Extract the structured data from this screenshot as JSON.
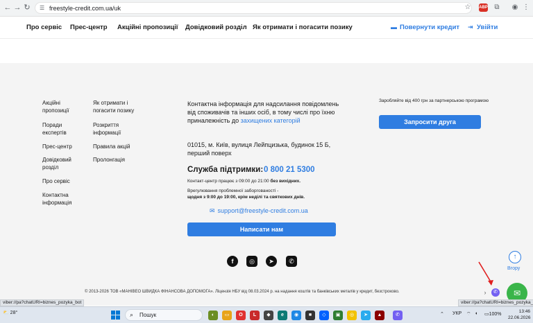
{
  "browser": {
    "url": "freestyle-credit.com.ua/uk",
    "abp_label": "ABP"
  },
  "header": {
    "menu": [
      "Про сервіс",
      "Прес-центр",
      "Акційні пропозиції",
      "Довідковий розділ",
      "Як отримати і погасити позику"
    ],
    "return_credit": "Повернути кредит",
    "login": "Увійти"
  },
  "footer": {
    "col1": [
      "Акційні пропозиції",
      "Поради експертів",
      "Прес-центр",
      "Довідковий розділ",
      "Про сервіс",
      "Контактна інформація"
    ],
    "col2": [
      "Як отримати і погасити позику",
      "Розкриття інформації",
      "Правила акцій",
      "Пролонгація"
    ],
    "contact_text": "Контактна інформація для надсилання повідомлень від споживачів та інших осіб, в тому числі про їхню приналежність до",
    "contact_link": "захищених категорій",
    "address": "01015, м. Київ, вулиця Лейпцизька, будинок 15 Б, перший поверх",
    "support_title": "Служба підтримки:",
    "support_phone": "0 800 21 5300",
    "hours_prefix": "Контакт-центр працює з 09:00 до 21:00",
    "hours_bold": "без вихідних.",
    "problem_text": "Врегулювання проблемної заборгованості -",
    "problem_bold": "щодня з 9:00 до 19:00, крім неділі та святкових днів.",
    "email": "support@freestyle-credit.com.ua",
    "write_button": "Написати нам",
    "partner_text": "Заробляйте від 400 грн за партнерською програмою",
    "invite_button": "Запросити друга",
    "copyright": "© 2013-2026 ТОВ «МАНІВЕО ШВИДКА ФІНАНСОВА ДОПОМОГА». Ліцензія НБУ від 08.03.2024 р. на надання коштів та банківських металів у кредит, безстроково.",
    "up_label": "Вгору"
  },
  "status": {
    "left": "viber://pa?chatURI=biznes_pozyka_bot",
    "right": "viber://pa?chatURI=biznes_pozyka_bot"
  },
  "taskbar": {
    "weather": "28°",
    "search": "Пошук",
    "lang": "УКР",
    "battery": "100%",
    "time": "13:46",
    "date": "22.06.2026"
  },
  "colors": {
    "accent": "#2f7de1",
    "footer_bg": "#f4f4f4",
    "chat": "#3ab54a",
    "viber": "#7360f2"
  }
}
